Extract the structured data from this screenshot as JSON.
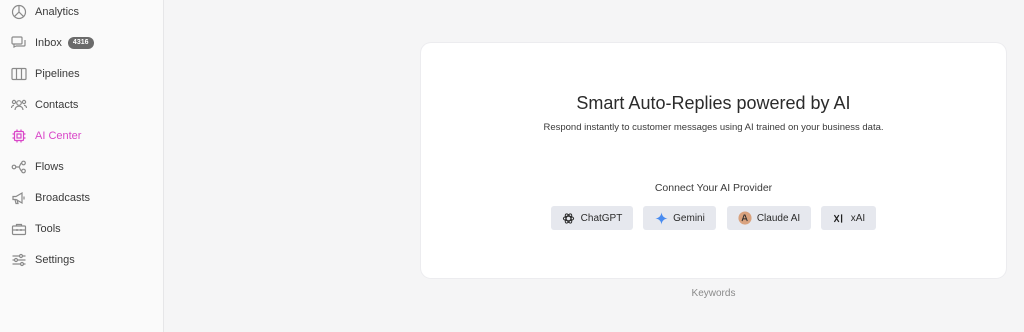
{
  "sidebar": {
    "items": [
      {
        "label": "Analytics",
        "icon": "analytics-icon"
      },
      {
        "label": "Inbox",
        "icon": "inbox-icon",
        "badge": "4316"
      },
      {
        "label": "Pipelines",
        "icon": "pipelines-icon"
      },
      {
        "label": "Contacts",
        "icon": "contacts-icon"
      },
      {
        "label": "AI Center",
        "icon": "ai-chip-icon",
        "active": true
      },
      {
        "label": "Flows",
        "icon": "flows-icon"
      },
      {
        "label": "Broadcasts",
        "icon": "megaphone-icon"
      },
      {
        "label": "Tools",
        "icon": "toolbox-icon"
      },
      {
        "label": "Settings",
        "icon": "sliders-icon"
      }
    ]
  },
  "main": {
    "title": "Smart Auto-Replies powered by AI",
    "subtitle": "Respond instantly to customer messages using AI trained on your business data.",
    "connect_label": "Connect Your AI Provider",
    "providers": [
      {
        "label": "ChatGPT",
        "icon": "openai-icon"
      },
      {
        "label": "Gemini",
        "icon": "gemini-sparkle-icon"
      },
      {
        "label": "Claude AI",
        "icon": "anthropic-icon"
      },
      {
        "label": "xAI",
        "icon": "xai-icon"
      }
    ],
    "keywords_label": "Keywords"
  },
  "colors": {
    "accent": "#d946c8",
    "gemini_blue": "#4a8cf0",
    "claude_orange": "#d9a27e"
  }
}
